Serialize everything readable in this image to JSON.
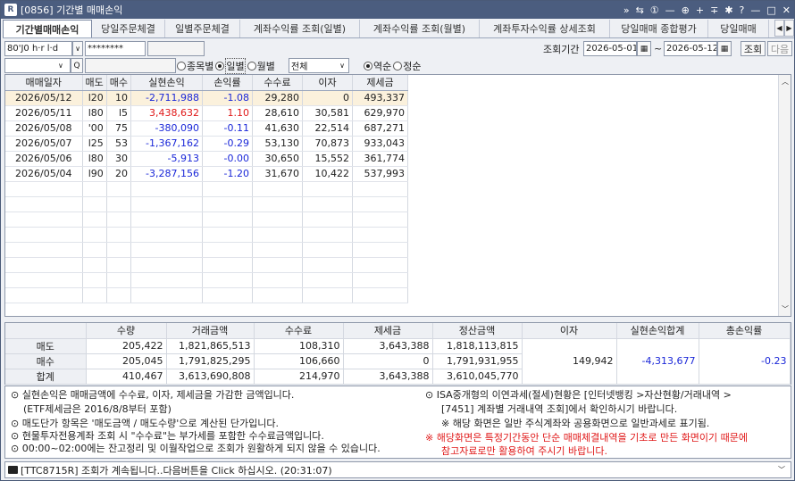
{
  "window": {
    "code": "[0856]",
    "title": "기간별 매매손익",
    "controls": [
      "»",
      "⇆",
      "①",
      "—",
      "⊕",
      "+",
      "∓",
      "✱",
      "?",
      "—",
      "□",
      "✕"
    ]
  },
  "tabs": [
    "기간별매매손익",
    "당일주문체결",
    "일별주문체결",
    "계좌수익률 조회(일별)",
    "계좌수익률 조회(월별)",
    "계좌투자수익률 상세조회",
    "당일매매 종합평가",
    "당일매매"
  ],
  "account": {
    "number": "80'J0 h·r l·d",
    "password": "********",
    "name": ""
  },
  "period": {
    "label": "조회기간",
    "start": "2026-05-01",
    "end": "2026-05-12",
    "tilde": "~",
    "search_btn": "조회",
    "next_btn": "다음"
  },
  "filter": {
    "stock_placeholder": "",
    "search_icon": "Q",
    "chevron": "∨",
    "radio_group": [
      {
        "label": "종목별",
        "on": false
      },
      {
        "label": "일별",
        "on": true
      },
      {
        "label": "월별",
        "on": false
      }
    ],
    "type_select": "전체",
    "order_group": [
      {
        "label": "역순",
        "on": true
      },
      {
        "label": "정순",
        "on": false
      }
    ]
  },
  "grid": {
    "headers": [
      "매매일자",
      "매도",
      "매수",
      "실현손익",
      "손익률",
      "수수료",
      "이자",
      "제세금"
    ],
    "rows": [
      {
        "date": "2026/05/12",
        "c2": "l20",
        "c3": "10",
        "pnl": "-2,711,988",
        "rate": "-1.08",
        "fee": "29,280",
        "interest": "0",
        "tax": "493,337",
        "sign": "neg"
      },
      {
        "date": "2026/05/11",
        "c2": "l80",
        "c3": "l5",
        "pnl": "3,438,632",
        "rate": "1.10",
        "fee": "28,610",
        "interest": "30,581",
        "tax": "629,970",
        "sign": "pos"
      },
      {
        "date": "2026/05/08",
        "c2": "'00",
        "c3": "75",
        "pnl": "-380,090",
        "rate": "-0.11",
        "fee": "41,630",
        "interest": "22,514",
        "tax": "687,271",
        "sign": "neg"
      },
      {
        "date": "2026/05/07",
        "c2": "l25",
        "c3": "53",
        "pnl": "-1,367,162",
        "rate": "-0.29",
        "fee": "53,130",
        "interest": "70,873",
        "tax": "933,043",
        "sign": "neg"
      },
      {
        "date": "2026/05/06",
        "c2": "l80",
        "c3": "30",
        "pnl": "-5,913",
        "rate": "-0.00",
        "fee": "30,650",
        "interest": "15,552",
        "tax": "361,774",
        "sign": "neg"
      },
      {
        "date": "2026/05/04",
        "c2": "l90",
        "c3": "20",
        "pnl": "-3,287,156",
        "rate": "-1.20",
        "fee": "31,670",
        "interest": "10,422",
        "tax": "537,993",
        "sign": "neg"
      }
    ]
  },
  "summary": {
    "headers": [
      "수량",
      "거래금액",
      "수수료",
      "제세금",
      "정산금액",
      "이자",
      "실현손익합계",
      "총손익률"
    ],
    "rows": [
      {
        "label": "매도",
        "qty": "205,422",
        "amount": "1,821,865,513",
        "fee": "108,310",
        "tax": "3,643,388",
        "settle": "1,818,113,815"
      },
      {
        "label": "매수",
        "qty": "205,045",
        "amount": "1,791,825,295",
        "fee": "106,660",
        "tax": "0",
        "settle": "1,791,931,955"
      },
      {
        "label": "합계",
        "qty": "410,467",
        "amount": "3,613,690,808",
        "fee": "214,970",
        "tax": "3,643,388",
        "settle": "3,610,045,770"
      }
    ],
    "interest": "149,942",
    "realized_total": "-4,313,677",
    "total_rate": "-0.23"
  },
  "notes": {
    "left": [
      "⊙ 실현손익은 매매금액에 수수료, 이자, 제세금을 가감한 금액입니다.",
      "(ETF제세금은 2016/8/8부터 포함)",
      "⊙ 매도단가 항목은 '매도금액 / 매도수량'으로 계산된 단가입니다.",
      "⊙ 현물투자전용계좌 조회 시 \"수수료\"는 부가세를 포함한 수수료금액입니다.",
      "⊙ 00:00~02:00에는 잔고정리 및 이월작업으로 조회가 원활하게 되지 않을 수 있습니다."
    ],
    "right": [
      "⊙ ISA중개형의 이연과세(절세)현황은 [인터넷뱅킹 >자산현황/거래내역 >",
      "[7451] 계좌별 거래내역 조회]에서 확인하시기 바랍니다.",
      "※ 해당 화면은 일반 주식계좌와 공용화면으로 일반과세로 표기됨.",
      "※ 해당화면은 특정기간동안 단순 매매체결내역을 기초로 만든 화면이기 때문에",
      "참고자료로만 활용하여 주시기 바랍니다."
    ]
  },
  "status": {
    "message": "[TTC8715R] 조회가 계속됩니다..다음버튼을 Click 하십시오. (20:31:07)"
  },
  "colors": {
    "title_bg": "#4b5d7f",
    "negative": "#1a27d8",
    "positive": "#e01818",
    "warning": "#e01818",
    "selected_row": "#fbf1dc"
  }
}
